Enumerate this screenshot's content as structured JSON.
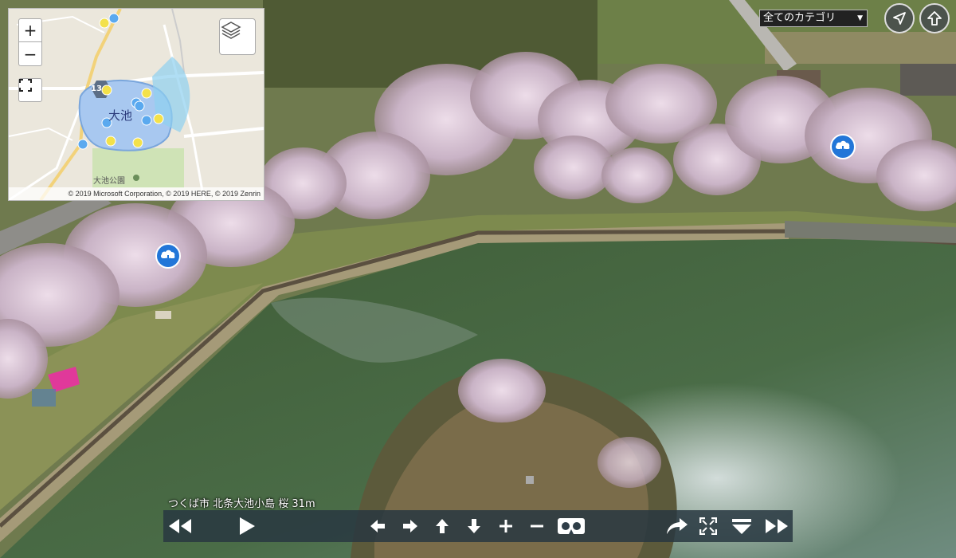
{
  "minimap": {
    "zoom_in": "+",
    "zoom_out": "−",
    "lake_label": "大池",
    "park_label": "大池公園",
    "route_number": "13",
    "copyright": "© 2019 Microsoft Corporation, © 2019 HERE, © 2019 Zenrin",
    "marker_colors": {
      "yellow": "#f3e14a",
      "blue": "#5aa9ef"
    }
  },
  "top_right": {
    "category_label": "全てのカテゴリ",
    "icons": [
      "locate-arrow-icon",
      "up-arrow-icon"
    ]
  },
  "hotspots": {
    "color": "#2276d8",
    "icon": "cloud-download-icon"
  },
  "toolbar": {
    "caption": "つくば市 北条大池小島 桜 31m",
    "buttons": [
      "rewind-icon",
      "play-icon",
      "pan-left-icon",
      "pan-right-icon",
      "pan-up-icon",
      "pan-down-icon",
      "zoom-in-icon",
      "zoom-out-icon",
      "vr-goggles-icon",
      "share-icon",
      "fullscreen-icon",
      "dropdown-icon",
      "fast-forward-icon"
    ]
  }
}
